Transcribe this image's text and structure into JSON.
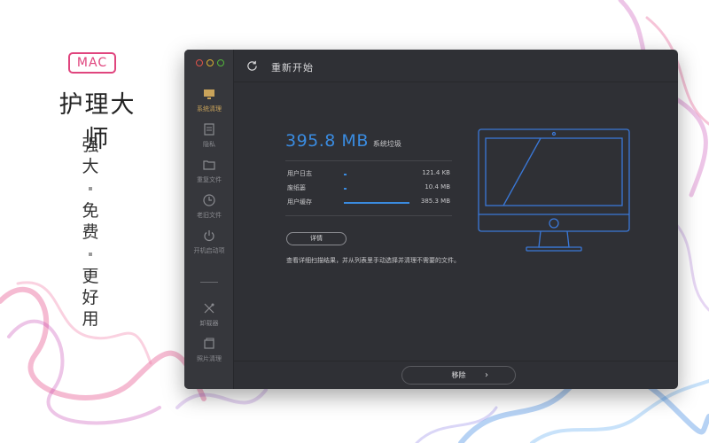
{
  "promo": {
    "badge": "MAC",
    "app_name": "护理大师",
    "slogan": [
      "强",
      "大",
      "免",
      "费",
      "更",
      "好",
      "用"
    ]
  },
  "window": {
    "title": "重新开始",
    "sidebar": [
      {
        "label": "系统清理",
        "icon": "monitor-icon",
        "active": true
      },
      {
        "label": "隐私",
        "icon": "list-icon",
        "active": false
      },
      {
        "label": "重复文件",
        "icon": "folder-icon",
        "active": false
      },
      {
        "label": "老旧文件",
        "icon": "clock-icon",
        "active": false
      },
      {
        "label": "开机启动项",
        "icon": "power-icon",
        "active": false
      },
      {
        "label": "卸载器",
        "icon": "uninstall-icon",
        "active": false
      },
      {
        "label": "照片清理",
        "icon": "photo-icon",
        "active": false
      }
    ],
    "summary": {
      "size": "395.8 MB",
      "label": "系统垃圾"
    },
    "items": [
      {
        "name": "用户日志",
        "value": "121.4 KB",
        "fraction": 0.03
      },
      {
        "name": "废纸篓",
        "value": "10.4 MB",
        "fraction": 0.03
      },
      {
        "name": "用户缓存",
        "value": "385.3 MB",
        "fraction": 0.97
      }
    ],
    "detail_button": "详情",
    "description": "查看详细扫描结果，并从列表里手动选择并清理不需要的文件。",
    "remove_button": "移除",
    "remove_arrow": "›",
    "accent_color": "#3a8be0"
  }
}
